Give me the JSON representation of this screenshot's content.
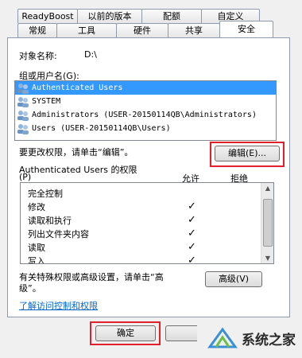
{
  "tabs_back": [
    "ReadyBoost",
    "以前的版本",
    "配额",
    "自定义"
  ],
  "tabs_front": [
    "常规",
    "工具",
    "硬件",
    "共享",
    "安全"
  ],
  "object_name": {
    "label": "对象名称:",
    "value": "D:\\"
  },
  "group_label": "组或用户名(G):",
  "users": [
    "Authenticated Users",
    "SYSTEM",
    "Administrators (USER-20150114QB\\Administrators)",
    "Users (USER-20150114QB\\Users)"
  ],
  "change_hint": "要更改权限，请单击“编辑”。",
  "edit_button": "编辑(E)...",
  "perm_title_line1": "Authenticated Users 的权限",
  "perm_title_line2": "(P)",
  "col_allow": "允许",
  "col_deny": "拒绝",
  "permissions": [
    {
      "name": "完全控制",
      "allow": ""
    },
    {
      "name": "修改",
      "allow": "✓"
    },
    {
      "name": "读取和执行",
      "allow": "✓"
    },
    {
      "name": "列出文件夹内容",
      "allow": "✓"
    },
    {
      "name": "读取",
      "allow": "✓"
    },
    {
      "name": "写入",
      "allow": "✓"
    }
  ],
  "advanced_hint_line1": "有关特殊权限或高级设置，请单击“高",
  "advanced_hint_line2": "级”。",
  "advanced_button": "高级(V)",
  "learn_link": "了解访问控制和权限",
  "ok_button": "确定",
  "watermark_text": "系统之家",
  "colors": {
    "selection": "#3399ff",
    "highlight_box": "#e0202a",
    "link": "#0066cc"
  }
}
